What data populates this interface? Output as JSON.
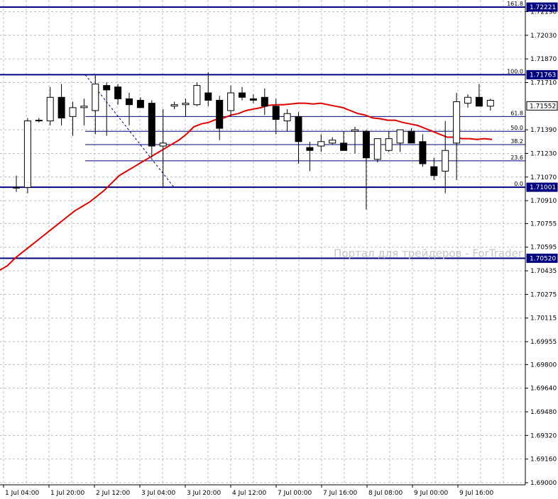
{
  "chart_data": {
    "type": "candlestick",
    "y_range": [
      1.69,
      1.7232
    ],
    "y_ticks": [
      {
        "value": 1.7219,
        "label": "1.72190"
      },
      {
        "value": 1.7203,
        "label": "1.72030"
      },
      {
        "value": 1.7187,
        "label": "1.71870"
      },
      {
        "value": 1.7171,
        "label": "1.71710"
      },
      {
        "value": 1.7139,
        "label": "1.71390"
      },
      {
        "value": 1.7123,
        "label": "1.71230"
      },
      {
        "value": 1.7107,
        "label": "1.71070"
      },
      {
        "value": 1.7091,
        "label": "1.70910"
      },
      {
        "value": 1.70755,
        "label": "1.70755"
      },
      {
        "value": 1.70595,
        "label": "1.70595"
      },
      {
        "value": 1.70435,
        "label": "1.70435"
      },
      {
        "value": 1.70275,
        "label": "1.70275"
      },
      {
        "value": 1.70115,
        "label": "1.70115"
      },
      {
        "value": 1.69955,
        "label": "1.69955"
      },
      {
        "value": 1.698,
        "label": "1.69800"
      },
      {
        "value": 1.6964,
        "label": "1.69640"
      },
      {
        "value": 1.6948,
        "label": "1.69480"
      },
      {
        "value": 1.6932,
        "label": "1.69320"
      },
      {
        "value": 1.6916,
        "label": "1.69160"
      },
      {
        "value": 1.69,
        "label": "1.69000"
      }
    ],
    "x_labels": [
      "1 Jul 04:00",
      "1 Jul 20:00",
      "2 Jul 12:00",
      "3 Jul 04:00",
      "3 Jul 20:00",
      "4 Jul 12:00",
      "7 Jul 00:00",
      "7 Jul 16:00",
      "8 Jul 08:00",
      "9 Jul 00:00",
      "9 Jul 16:00"
    ],
    "candles": [
      [
        1.71,
        1.7108,
        1.7097,
        1.71
      ],
      [
        1.71,
        1.7147,
        1.7096,
        1.7145
      ],
      [
        1.7145,
        1.7147,
        1.7144,
        1.71455
      ],
      [
        1.7145,
        1.7168,
        1.7142,
        1.7161
      ],
      [
        1.7161,
        1.717,
        1.7142,
        1.7147
      ],
      [
        1.7148,
        1.7158,
        1.7135,
        1.7154
      ],
      [
        1.7154,
        1.716,
        1.7142,
        1.7155
      ],
      [
        1.7152,
        1.7176,
        1.7136,
        1.717
      ],
      [
        1.7169,
        1.7171,
        1.7135,
        1.7166
      ],
      [
        1.7168,
        1.717,
        1.7156,
        1.716
      ],
      [
        1.716,
        1.7164,
        1.7142,
        1.7156
      ],
      [
        1.7159,
        1.7161,
        1.7155,
        1.7154
      ],
      [
        1.7157,
        1.7159,
        1.712,
        1.7128
      ],
      [
        1.7128,
        1.7153,
        1.71,
        1.713
      ],
      [
        1.7155,
        1.7158,
        1.7153,
        1.7156
      ],
      [
        1.7156,
        1.716,
        1.7148,
        1.7157
      ],
      [
        1.7156,
        1.7171,
        1.7155,
        1.7169
      ],
      [
        1.7164,
        1.7178,
        1.7155,
        1.7159
      ],
      [
        1.7159,
        1.7162,
        1.7132,
        1.714
      ],
      [
        1.7152,
        1.7169,
        1.7148,
        1.7164
      ],
      [
        1.7164,
        1.7168,
        1.7159,
        1.7161
      ],
      [
        1.716,
        1.7163,
        1.7157,
        1.7159
      ],
      [
        1.7161,
        1.7167,
        1.7149,
        1.7155
      ],
      [
        1.7155,
        1.716,
        1.7136,
        1.7146
      ],
      [
        1.7145,
        1.7153,
        1.7138,
        1.715
      ],
      [
        1.7148,
        1.7151,
        1.7116,
        1.7131
      ],
      [
        1.7127,
        1.7131,
        1.7111,
        1.7125
      ],
      [
        1.7128,
        1.7136,
        1.7124,
        1.7131
      ],
      [
        1.713,
        1.7134,
        1.7129,
        1.7132
      ],
      [
        1.713,
        1.7138,
        1.7125,
        1.7125
      ],
      [
        1.7138,
        1.7141,
        1.7123,
        1.7139
      ],
      [
        1.7138,
        1.7139,
        1.7085,
        1.712
      ],
      [
        1.7119,
        1.7125,
        1.7117,
        1.7133
      ],
      [
        1.7125,
        1.7138,
        1.7124,
        1.7133
      ],
      [
        1.713,
        1.7138,
        1.7124,
        1.7139
      ],
      [
        1.7138,
        1.714,
        1.7131,
        1.713
      ],
      [
        1.7131,
        1.7136,
        1.7114,
        1.7116
      ],
      [
        1.7114,
        1.712,
        1.7105,
        1.7108
      ],
      [
        1.7111,
        1.7145,
        1.7096,
        1.7125
      ],
      [
        1.713,
        1.7164,
        1.7105,
        1.7158
      ],
      [
        1.7157,
        1.7163,
        1.7154,
        1.7161
      ],
      [
        1.7161,
        1.717,
        1.7155,
        1.7155
      ],
      [
        1.7155,
        1.716,
        1.7152,
        1.7159
      ]
    ],
    "moving_average": [
      1.7044,
      1.7047,
      1.7052,
      1.7056,
      1.706,
      1.7064,
      1.7068,
      1.7072,
      1.7076,
      1.708,
      1.7084,
      1.7087,
      1.709,
      1.7094,
      1.7098,
      1.7103,
      1.7108,
      1.7111,
      1.7114,
      1.7117,
      1.712,
      1.7123,
      1.7126,
      1.7129,
      1.7132,
      1.7136,
      1.7141,
      1.7143,
      1.7144,
      1.7146,
      1.7147,
      1.7149,
      1.715,
      1.7152,
      1.7153,
      1.7154,
      1.71555,
      1.7156,
      1.7156,
      1.71565,
      1.7157,
      1.7157,
      1.71565,
      1.7157,
      1.7156,
      1.7155,
      1.7154,
      1.7152,
      1.715,
      1.7149,
      1.7147,
      1.71465,
      1.71455,
      1.71455,
      1.7144,
      1.7143,
      1.7142,
      1.714,
      1.7138,
      1.7136,
      1.7134,
      1.7134,
      1.7133,
      1.7133,
      1.71325,
      1.7133,
      1.71325
    ],
    "fibonacci": {
      "levels": [
        {
          "label": "161.8",
          "value": 1.72221,
          "box": "1.72221"
        },
        {
          "label": "100.0",
          "value": 1.71763,
          "box": "1.71763"
        },
        {
          "label": "61.8",
          "value": 1.7148,
          "box": ""
        },
        {
          "label": "50.0",
          "value": 1.7138,
          "box": ""
        },
        {
          "label": "38.2",
          "value": 1.7129,
          "box": ""
        },
        {
          "label": "23.6",
          "value": 1.7118,
          "box": ""
        },
        {
          "label": "0.0",
          "value": 1.71001,
          "box": "1.71001"
        }
      ],
      "trend_line": {
        "from_price": 1.71763,
        "to_price": 1.71001
      }
    },
    "horizontal_line": {
      "value": 1.7052,
      "box": "1.70520"
    },
    "current_price": {
      "value": 1.71552,
      "box": "1.71552"
    },
    "watermark": "Портал для трейдеров - ForTrader",
    "grid": true
  },
  "colors": {
    "bull_body": "#ffffff",
    "bear_body": "#000000",
    "ma_line": "#e00000",
    "fib_line": "#000080",
    "grid_line": "#c0c0c0"
  }
}
